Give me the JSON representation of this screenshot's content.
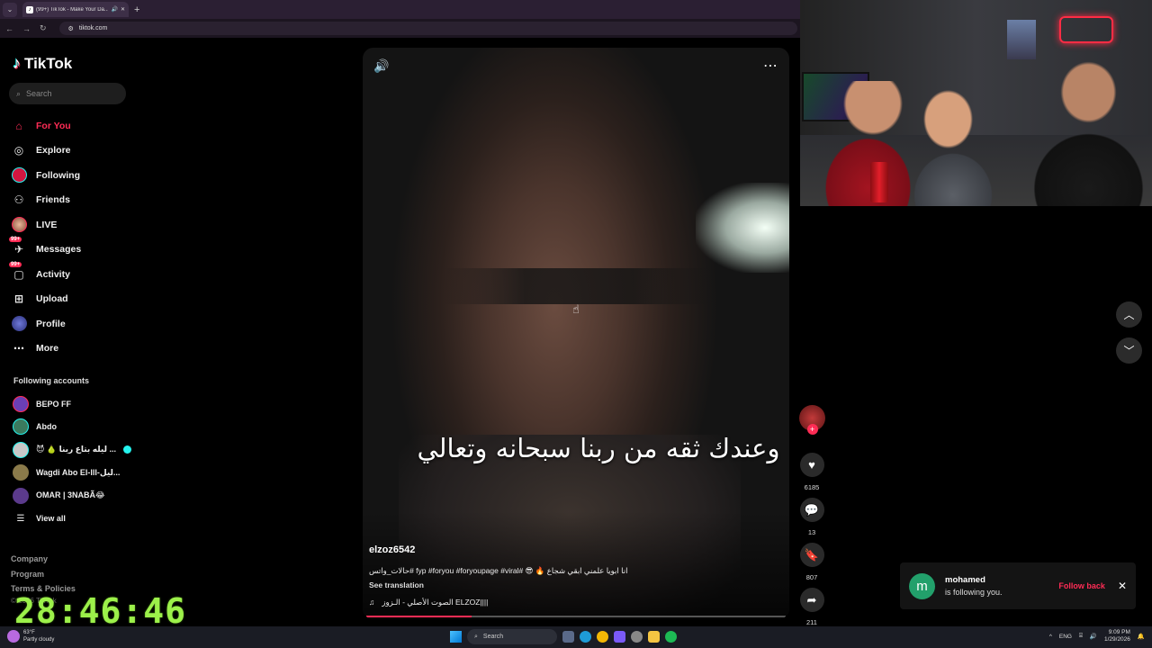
{
  "browser": {
    "tab_title": "(99+) TikTok - Make Your Da...",
    "url": "tiktok.com",
    "new_tab": "+"
  },
  "sidebar": {
    "logo": "TikTok",
    "search_placeholder": "Search",
    "nav": [
      {
        "label": "For You",
        "icon": "home-icon",
        "active": true
      },
      {
        "label": "Explore",
        "icon": "compass-icon"
      },
      {
        "label": "Following",
        "icon": "following-avatar-icon"
      },
      {
        "label": "Friends",
        "icon": "friends-icon"
      },
      {
        "label": "LIVE",
        "icon": "live-avatar-icon"
      },
      {
        "label": "Messages",
        "icon": "messages-icon",
        "badge": "99+"
      },
      {
        "label": "Activity",
        "icon": "activity-icon",
        "badge": "99+"
      },
      {
        "label": "Upload",
        "icon": "upload-icon"
      },
      {
        "label": "Profile",
        "icon": "profile-avatar-icon"
      },
      {
        "label": "More",
        "icon": "more-dots-icon"
      }
    ],
    "following_title": "Following accounts",
    "following": [
      {
        "name": "BEPO FF",
        "color": "#6a3fb5"
      },
      {
        "name": "Abdo",
        "color": "#3b7a5e"
      },
      {
        "name": "😈 🍐 ليله بتاع ربنا ...",
        "color": "#c8c8c8",
        "live": true
      },
      {
        "name": "Wagdi Abo El-lll-ليل...",
        "color": "#8a7a4a"
      },
      {
        "name": "OMAR | 3NABÃ😂",
        "color": "#5b3a8c"
      }
    ],
    "view_all": "View all",
    "footer": [
      "Company",
      "Program",
      "Terms & Policies"
    ],
    "copyright": "© 2026 TikTok"
  },
  "timer": "28:46:46",
  "video": {
    "subtitle": "وعندك ثقه من ربنا سبحانه وتعالي",
    "author": "elzoz6542",
    "caption": "حالات_واتس# fyp #foryou #foryoupage #viral# 😎 🔥 انا ابويا علمني ابقي شجاع",
    "see_translation": "See translation",
    "music": "الصوت الأصلي - الـزوز ELZOZ||||",
    "progress": 0.25
  },
  "actions": {
    "likes": "6185",
    "comments": "13",
    "saves": "807",
    "shares": "211"
  },
  "notification": {
    "avatar_letter": "m",
    "name": "mohamed",
    "message": "is following you.",
    "follow_back": "Follow back"
  },
  "taskbar": {
    "temperature": "63°F",
    "weather": "Partly cloudy",
    "search": "Search",
    "language": "ENG",
    "time": "9:09 PM",
    "date": "1/29/2026"
  }
}
